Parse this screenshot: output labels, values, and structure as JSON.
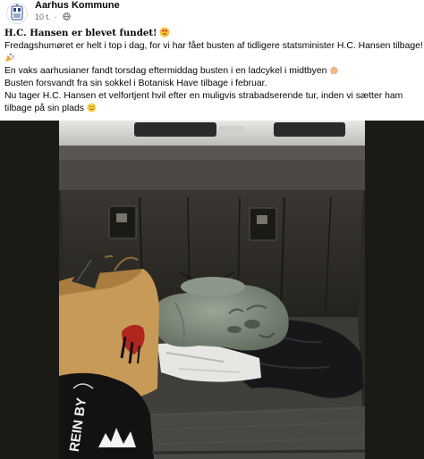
{
  "post": {
    "author": "Aarhus Kommune",
    "time": "10 t.",
    "separator": "·",
    "privacy_icon": "globe-icon",
    "headline": "H.C. Hansen er blevet fundet!",
    "headline_emoji": "heart-eyes-emoji",
    "lines": [
      "Fredagshumøret er helt i top i dag, for vi har fået busten af tidligere statsminister H.C. Hansen tilbage!",
      "En vaks aarhusianer fandt torsdag eftermiddag busten i en ladcykel i midtbyen",
      "Busten forsvandt fra sin sokkel i Botanisk Have tilbage i februar.",
      "Nu tager H.C. Hansen et velfortjent hvil efter en muligvis strabadserende tur, inden vi sætter ham",
      "tilbage på sin plads"
    ],
    "emojis": {
      "line1": "party-popper-emoji",
      "line2": "clapping-hands-emoji",
      "line5": "smiley-emoji"
    }
  },
  "photo": {
    "bag_brand": "REIN BY",
    "colors": {
      "dark_bg": "#1c1a15",
      "bust": "#7f8a7c",
      "paper_bag": "#c79a58"
    }
  }
}
